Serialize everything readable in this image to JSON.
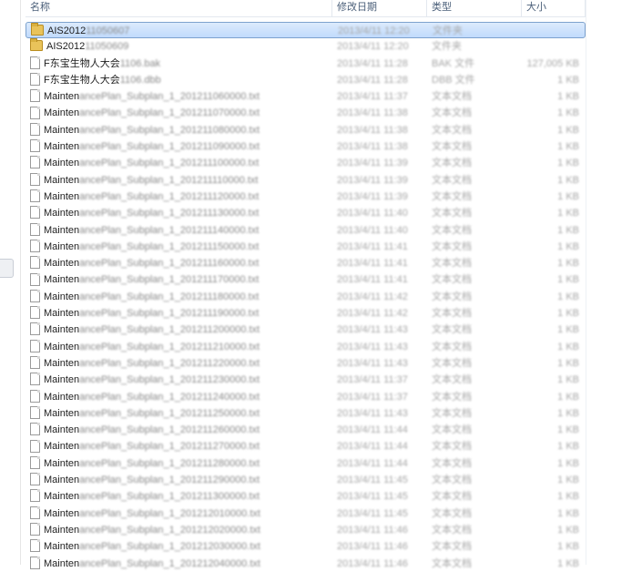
{
  "columns": {
    "name": "名称",
    "date": "修改日期",
    "type": "类型",
    "size": "大小"
  },
  "files": [
    {
      "icon": "folder",
      "visible": "AIS2012",
      "obscured": "11050607",
      "date": "2013/4/11 12:20",
      "type": "文件夹",
      "size": "",
      "selected": true
    },
    {
      "icon": "folder",
      "visible": "AIS2012",
      "obscured": "11050609",
      "date": "2013/4/11 12:20",
      "type": "文件夹",
      "size": "",
      "selected": false
    },
    {
      "icon": "file",
      "visible": "F东宝生物人大会",
      "obscured": "1106.bak",
      "date": "2013/4/11 11:28",
      "type": "BAK 文件",
      "size": "127,005 KB",
      "selected": false
    },
    {
      "icon": "file",
      "visible": "F东宝生物人大会",
      "obscured": "1106.dbb",
      "date": "2013/4/11 11:28",
      "type": "DBB 文件",
      "size": "1 KB",
      "selected": false
    },
    {
      "icon": "file",
      "visible": "Mainten",
      "obscured": "ancePlan_Subplan_1_201211060000.txt",
      "date": "2013/4/11 11:37",
      "type": "文本文档",
      "size": "1 KB",
      "selected": false
    },
    {
      "icon": "file",
      "visible": "Mainten",
      "obscured": "ancePlan_Subplan_1_201211070000.txt",
      "date": "2013/4/11 11:38",
      "type": "文本文档",
      "size": "1 KB",
      "selected": false
    },
    {
      "icon": "file",
      "visible": "Mainten",
      "obscured": "ancePlan_Subplan_1_201211080000.txt",
      "date": "2013/4/11 11:38",
      "type": "文本文档",
      "size": "1 KB",
      "selected": false
    },
    {
      "icon": "file",
      "visible": "Mainten",
      "obscured": "ancePlan_Subplan_1_201211090000.txt",
      "date": "2013/4/11 11:38",
      "type": "文本文档",
      "size": "1 KB",
      "selected": false
    },
    {
      "icon": "file",
      "visible": "Mainten",
      "obscured": "ancePlan_Subplan_1_201211100000.txt",
      "date": "2013/4/11 11:39",
      "type": "文本文档",
      "size": "1 KB",
      "selected": false
    },
    {
      "icon": "file",
      "visible": "Mainten",
      "obscured": "ancePlan_Subplan_1_201211110000.txt",
      "date": "2013/4/11 11:39",
      "type": "文本文档",
      "size": "1 KB",
      "selected": false
    },
    {
      "icon": "file",
      "visible": "Mainten",
      "obscured": "ancePlan_Subplan_1_201211120000.txt",
      "date": "2013/4/11 11:39",
      "type": "文本文档",
      "size": "1 KB",
      "selected": false
    },
    {
      "icon": "file",
      "visible": "Mainten",
      "obscured": "ancePlan_Subplan_1_201211130000.txt",
      "date": "2013/4/11 11:40",
      "type": "文本文档",
      "size": "1 KB",
      "selected": false
    },
    {
      "icon": "file",
      "visible": "Mainten",
      "obscured": "ancePlan_Subplan_1_201211140000.txt",
      "date": "2013/4/11 11:40",
      "type": "文本文档",
      "size": "1 KB",
      "selected": false
    },
    {
      "icon": "file",
      "visible": "Mainten",
      "obscured": "ancePlan_Subplan_1_201211150000.txt",
      "date": "2013/4/11 11:41",
      "type": "文本文档",
      "size": "1 KB",
      "selected": false
    },
    {
      "icon": "file",
      "visible": "Mainten",
      "obscured": "ancePlan_Subplan_1_201211160000.txt",
      "date": "2013/4/11 11:41",
      "type": "文本文档",
      "size": "1 KB",
      "selected": false
    },
    {
      "icon": "file",
      "visible": "Mainten",
      "obscured": "ancePlan_Subplan_1_201211170000.txt",
      "date": "2013/4/11 11:41",
      "type": "文本文档",
      "size": "1 KB",
      "selected": false
    },
    {
      "icon": "file",
      "visible": "Mainten",
      "obscured": "ancePlan_Subplan_1_201211180000.txt",
      "date": "2013/4/11 11:42",
      "type": "文本文档",
      "size": "1 KB",
      "selected": false
    },
    {
      "icon": "file",
      "visible": "Mainten",
      "obscured": "ancePlan_Subplan_1_201211190000.txt",
      "date": "2013/4/11 11:42",
      "type": "文本文档",
      "size": "1 KB",
      "selected": false
    },
    {
      "icon": "file",
      "visible": "Mainten",
      "obscured": "ancePlan_Subplan_1_201211200000.txt",
      "date": "2013/4/11 11:43",
      "type": "文本文档",
      "size": "1 KB",
      "selected": false
    },
    {
      "icon": "file",
      "visible": "Mainten",
      "obscured": "ancePlan_Subplan_1_201211210000.txt",
      "date": "2013/4/11 11:43",
      "type": "文本文档",
      "size": "1 KB",
      "selected": false
    },
    {
      "icon": "file",
      "visible": "Mainten",
      "obscured": "ancePlan_Subplan_1_201211220000.txt",
      "date": "2013/4/11 11:43",
      "type": "文本文档",
      "size": "1 KB",
      "selected": false
    },
    {
      "icon": "file",
      "visible": "Mainten",
      "obscured": "ancePlan_Subplan_1_201211230000.txt",
      "date": "2013/4/11 11:37",
      "type": "文本文档",
      "size": "1 KB",
      "selected": false
    },
    {
      "icon": "file",
      "visible": "Mainten",
      "obscured": "ancePlan_Subplan_1_201211240000.txt",
      "date": "2013/4/11 11:37",
      "type": "文本文档",
      "size": "1 KB",
      "selected": false
    },
    {
      "icon": "file",
      "visible": "Mainten",
      "obscured": "ancePlan_Subplan_1_201211250000.txt",
      "date": "2013/4/11 11:43",
      "type": "文本文档",
      "size": "1 KB",
      "selected": false
    },
    {
      "icon": "file",
      "visible": "Mainten",
      "obscured": "ancePlan_Subplan_1_201211260000.txt",
      "date": "2013/4/11 11:44",
      "type": "文本文档",
      "size": "1 KB",
      "selected": false
    },
    {
      "icon": "file",
      "visible": "Mainten",
      "obscured": "ancePlan_Subplan_1_201211270000.txt",
      "date": "2013/4/11 11:44",
      "type": "文本文档",
      "size": "1 KB",
      "selected": false
    },
    {
      "icon": "file",
      "visible": "Mainten",
      "obscured": "ancePlan_Subplan_1_201211280000.txt",
      "date": "2013/4/11 11:44",
      "type": "文本文档",
      "size": "1 KB",
      "selected": false
    },
    {
      "icon": "file",
      "visible": "Mainten",
      "obscured": "ancePlan_Subplan_1_201211290000.txt",
      "date": "2013/4/11 11:45",
      "type": "文本文档",
      "size": "1 KB",
      "selected": false
    },
    {
      "icon": "file",
      "visible": "Mainten",
      "obscured": "ancePlan_Subplan_1_201211300000.txt",
      "date": "2013/4/11 11:45",
      "type": "文本文档",
      "size": "1 KB",
      "selected": false
    },
    {
      "icon": "file",
      "visible": "Mainten",
      "obscured": "ancePlan_Subplan_1_201212010000.txt",
      "date": "2013/4/11 11:45",
      "type": "文本文档",
      "size": "1 KB",
      "selected": false
    },
    {
      "icon": "file",
      "visible": "Mainten",
      "obscured": "ancePlan_Subplan_1_201212020000.txt",
      "date": "2013/4/11 11:46",
      "type": "文本文档",
      "size": "1 KB",
      "selected": false
    },
    {
      "icon": "file",
      "visible": "Mainten",
      "obscured": "ancePlan_Subplan_1_201212030000.txt",
      "date": "2013/4/11 11:46",
      "type": "文本文档",
      "size": "1 KB",
      "selected": false
    },
    {
      "icon": "file",
      "visible": "Mainten",
      "obscured": "ancePlan_Subplan_1_201212040000.txt",
      "date": "2013/4/11 11:46",
      "type": "文本文档",
      "size": "1 KB",
      "selected": false
    }
  ],
  "colors": {
    "header_text": "#4c607a",
    "selection_fill": "#c1dbfc",
    "selection_border": "#7da2ce",
    "folder": "#e9c35a"
  }
}
